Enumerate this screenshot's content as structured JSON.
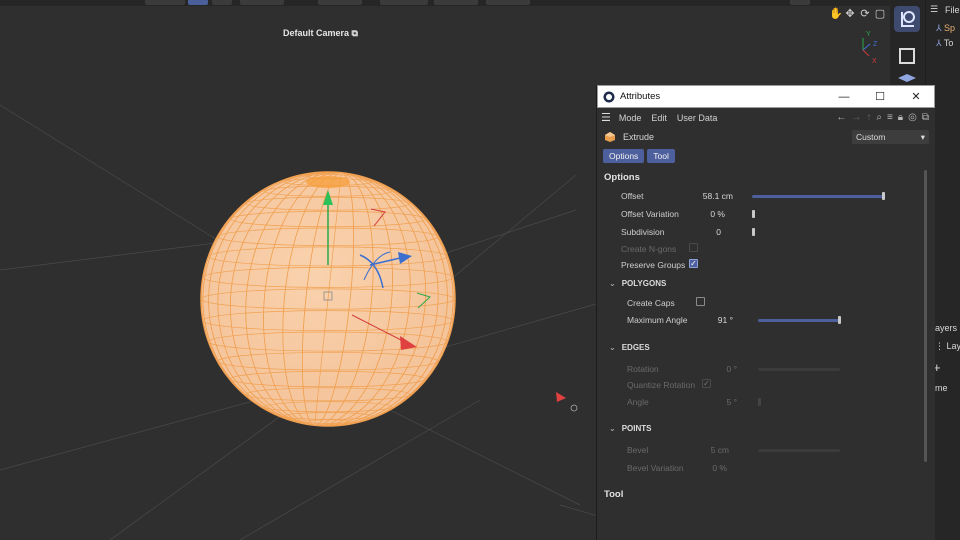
{
  "viewport": {
    "camera_label": "Default Camera",
    "axis_labels": [
      "Y",
      "Z",
      "X"
    ]
  },
  "right_strip": {
    "menu_label": "File",
    "tree_items": [
      "Sp",
      "To"
    ],
    "layers_label": "ayers",
    "layer_label": "Lay",
    "name_label": "me"
  },
  "attributes": {
    "window_title": "Attributes",
    "menu": [
      "Mode",
      "Edit",
      "User Data"
    ],
    "object_label": "Extrude",
    "mode_select": "Custom",
    "tabs": [
      "Options",
      "Tool"
    ],
    "options_title": "Options",
    "tool_title": "Tool",
    "fields": {
      "offset": {
        "label": "Offset",
        "value": "58.1 cm",
        "level": 1.0
      },
      "offset_variation": {
        "label": "Offset Variation",
        "value": "0 %",
        "level": 0.0
      },
      "subdivision": {
        "label": "Subdivision",
        "value": "0",
        "level": 0.0
      },
      "create_ngons": {
        "label": "Create N-gons",
        "checked": false
      },
      "preserve_groups": {
        "label": "Preserve Groups",
        "checked": true
      }
    },
    "polygons": {
      "title": "POLYGONS",
      "create_caps": {
        "label": "Create Caps",
        "checked": false
      },
      "max_angle": {
        "label": "Maximum Angle",
        "value": "91 °",
        "level": 1.0
      }
    },
    "edges": {
      "title": "EDGES",
      "rotation": {
        "label": "Rotation",
        "value": "0 °"
      },
      "quantize_rotation": {
        "label": "Quantize Rotation",
        "checked": true
      },
      "angle": {
        "label": "Angle",
        "value": "5 °"
      }
    },
    "points": {
      "title": "POINTS",
      "bevel": {
        "label": "Bevel",
        "value": "5 cm"
      },
      "bevel_variation": {
        "label": "Bevel Variation",
        "value": "0 %"
      }
    }
  },
  "colors": {
    "accent": "#4d5f9c",
    "sphere": "#f7c9a0",
    "sphere_wire": "#f0a050",
    "viewport_bg": "#2f2f2f"
  }
}
